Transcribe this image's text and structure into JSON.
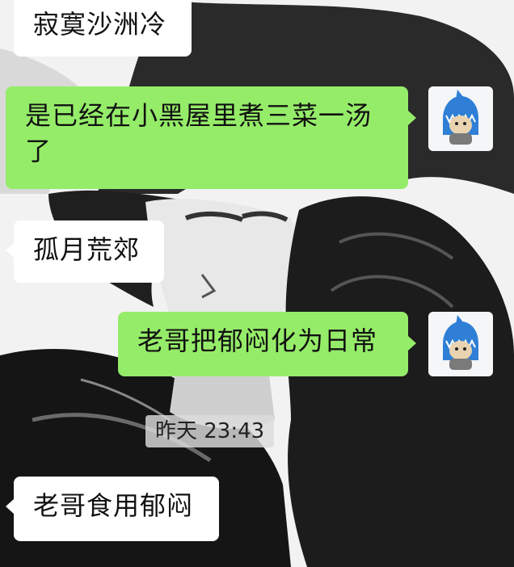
{
  "chat": {
    "messages": [
      {
        "side": "left",
        "text": "寂寞沙洲冷"
      },
      {
        "side": "right",
        "text": "是已经在小黑屋里煮三菜一汤了"
      },
      {
        "side": "left",
        "text": "孤月荒郊"
      },
      {
        "side": "right",
        "text": "老哥把郁闷化为日常"
      },
      {
        "side": "left",
        "text": "老哥食用郁闷"
      }
    ],
    "timestamp": "昨天 23:43"
  },
  "colors": {
    "outgoing_bubble": "#95ec69",
    "incoming_bubble": "#ffffff"
  },
  "icons": {
    "avatar": "shark-hoodie-avatar-icon"
  }
}
